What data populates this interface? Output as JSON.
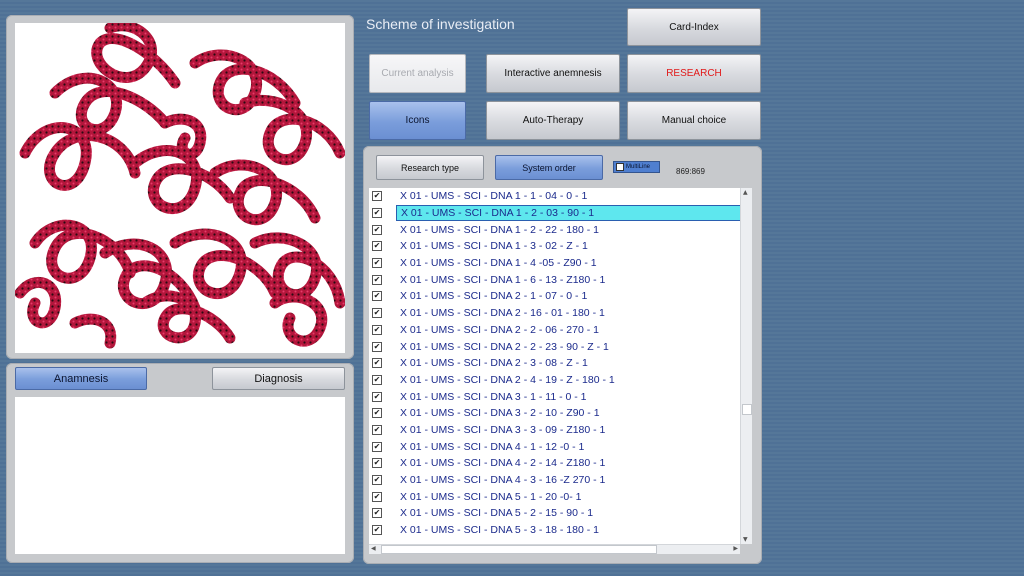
{
  "header": {
    "title": "Scheme of investigation"
  },
  "top_buttons": {
    "card_index": "Card-Index",
    "current_analysis": "Current analysis",
    "interactive_anamnesis": "Interactive anemnesis",
    "research": "RESEARCH",
    "icons": "Icons",
    "auto_therapy": "Auto-Therapy",
    "manual_choice": "Manual choice"
  },
  "list_toolbar": {
    "research_type": "Research type",
    "system_order": "System order",
    "multiline_label": "MultiLine",
    "counter": "869:869"
  },
  "left_panel": {
    "anamnesis_tab": "Anamnesis",
    "diagnosis_tab": "Diagnosis"
  },
  "list": {
    "selected_index": 1,
    "items": [
      "X 01 - UMS - SCI - DNA 1 - 1 - 04 - 0 - 1",
      "X 01 - UMS - SCI - DNA 1 - 2 - 03 - 90 - 1",
      "X 01 - UMS - SCI - DNA 1 - 2 - 22 - 180 - 1",
      "X 01 - UMS - SCI - DNA 1 - 3 - 02 - Z - 1",
      "X 01 - UMS - SCI - DNA 1 - 4 -05 - Z90 - 1",
      "X 01 - UMS - SCI - DNA 1 - 6 - 13 - Z180 - 1",
      "X 01 - UMS - SCI - DNA 2 - 1 - 07 - 0 - 1",
      "X 01 - UMS - SCI - DNA 2 - 16 - 01 - 180 - 1",
      "X 01 - UMS - SCI - DNA 2 - 2 - 06 - 270 - 1",
      "X 01 - UMS - SCI - DNA 2 - 2 - 23 - 90 - Z - 1",
      "X 01 - UMS - SCI - DNA 2 - 3 - 08 - Z -  1",
      "X 01 - UMS - SCI - DNA 2 - 4 - 19 - Z - 180 - 1",
      "X 01 - UMS - SCI - DNA 3 - 1 - 11 - 0 - 1",
      "X 01 - UMS - SCI - DNA 3 - 2 - 10 - Z90 - 1",
      "X 01 - UMS - SCI - DNA 3 - 3 - 09 - Z180 - 1",
      "X 01 - UMS - SCI - DNA 4 - 1 - 12 -0 - 1",
      "X 01 - UMS - SCI - DNA 4 - 2 - 14 - Z180 - 1",
      "X 01 - UMS - SCI - DNA 4 - 3 - 16 -Z 270 - 1",
      "X 01 - UMS - SCI - DNA 5 - 1 - 20 -0- 1",
      "X 01 - UMS - SCI - DNA 5 - 2 - 15 - 90 - 1",
      "X 01 - UMS - SCI - DNA 5 - 3 - 18 - 180 - 1"
    ]
  },
  "colors": {
    "background": "#557799",
    "accent_button": "#7a9ddb",
    "selection": "#5ee7ee",
    "list_text": "#1b2a8c",
    "research_text": "#e11919"
  },
  "icons": {
    "checkbox": "checkmark",
    "scroll_up": "arrow-up-icon",
    "scroll_down": "arrow-down-icon",
    "scroll_left": "arrow-left-icon",
    "scroll_right": "arrow-right-icon"
  }
}
